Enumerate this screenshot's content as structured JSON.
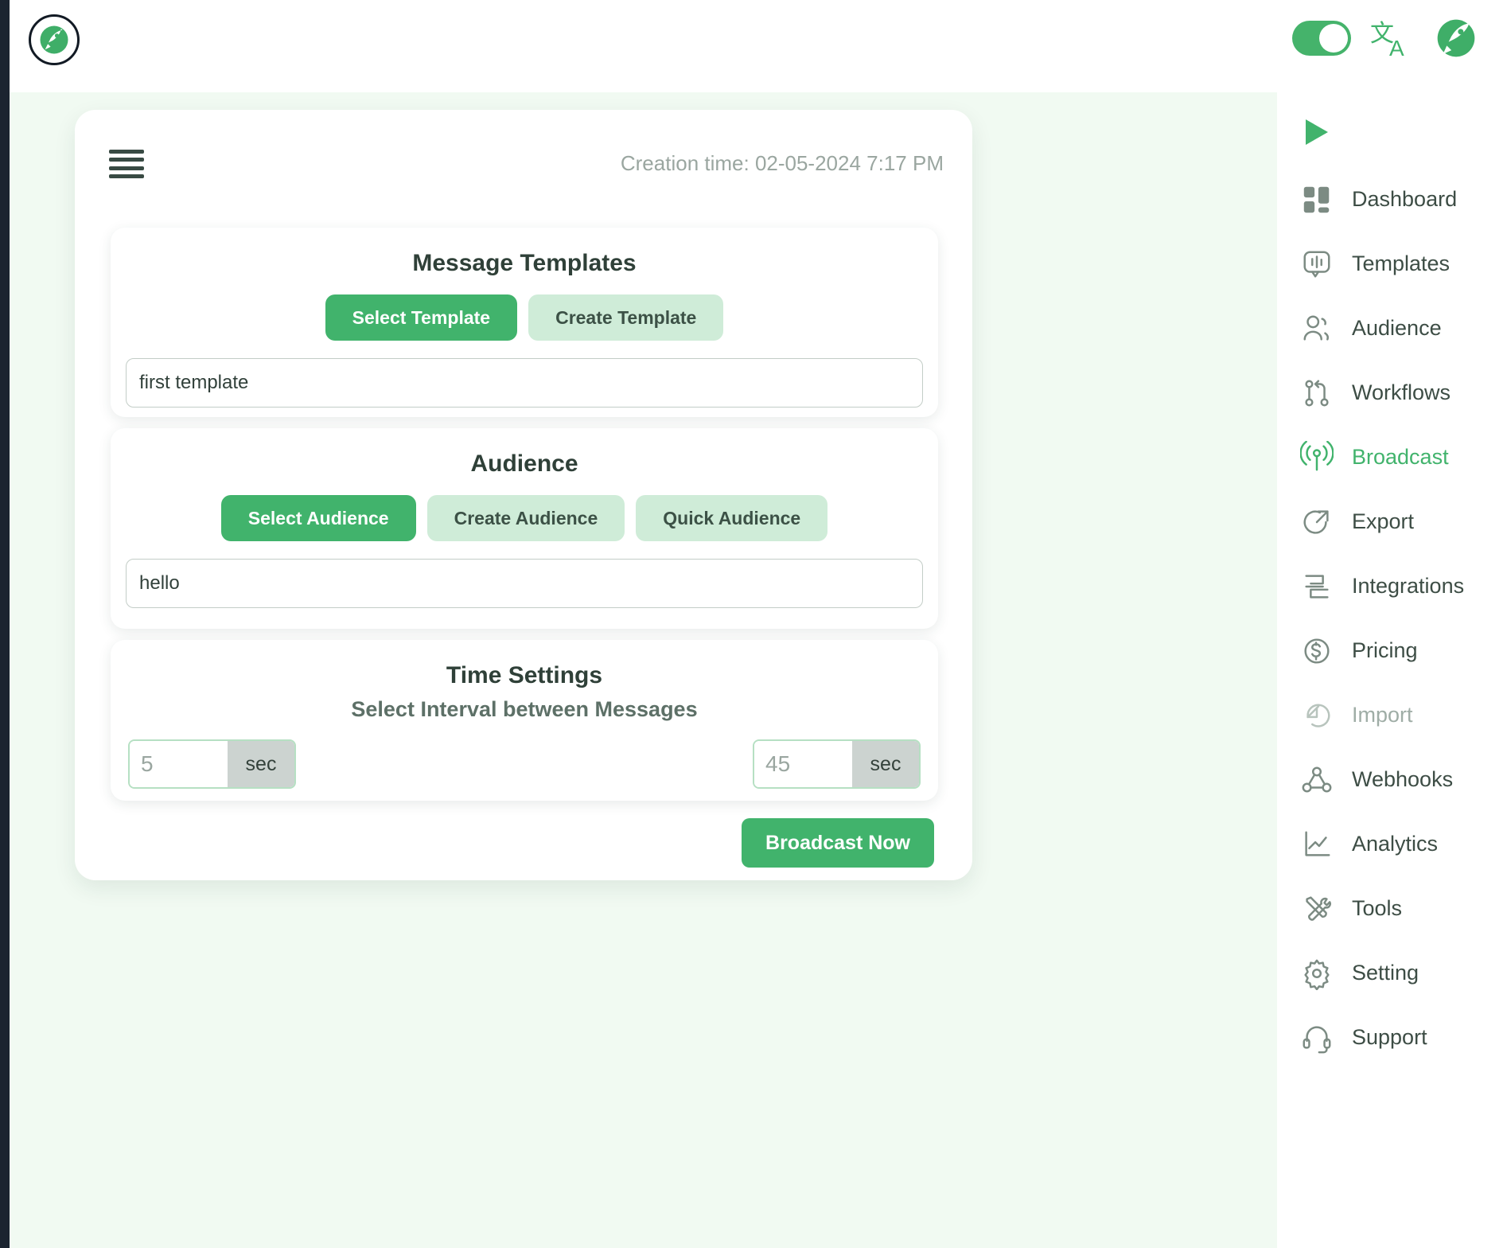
{
  "header": {
    "logo_icon": "rocket-logo-icon",
    "language_toggle_on": true,
    "translate_icon": "translate-icon",
    "rocket_icon": "rocket-icon"
  },
  "panel": {
    "menu_icon": "hamburger-menu-icon",
    "creation_time": "Creation time: 02-05-2024 7:17 PM"
  },
  "templates": {
    "title": "Message Templates",
    "select_button": "Select Template",
    "create_button": "Create Template",
    "input_value": "first template",
    "input_placeholder": "first template"
  },
  "audience": {
    "title": "Audience",
    "select_button": "Select Audience",
    "create_button": "Create Audience",
    "quick_button": "Quick Audience",
    "input_value": "hello",
    "input_placeholder": "hello"
  },
  "time_settings": {
    "title": "Time Settings",
    "subtitle": "Select Interval between Messages",
    "min_value": "5",
    "min_unit": "sec",
    "max_value": "45",
    "max_unit": "sec"
  },
  "actions": {
    "broadcast": "Broadcast Now"
  },
  "sidebar": {
    "play_icon": "play-icon",
    "items": [
      {
        "label": "Dashboard",
        "icon": "dashboard-icon",
        "state": "normal"
      },
      {
        "label": "Templates",
        "icon": "templates-icon",
        "state": "normal"
      },
      {
        "label": "Audience",
        "icon": "audience-icon",
        "state": "normal"
      },
      {
        "label": "Workflows",
        "icon": "workflows-icon",
        "state": "normal"
      },
      {
        "label": "Broadcast",
        "icon": "broadcast-icon",
        "state": "active"
      },
      {
        "label": "Export",
        "icon": "export-icon",
        "state": "normal"
      },
      {
        "label": "Integrations",
        "icon": "integrations-icon",
        "state": "normal"
      },
      {
        "label": "Pricing",
        "icon": "pricing-icon",
        "state": "normal"
      },
      {
        "label": "Import",
        "icon": "import-icon",
        "state": "dim"
      },
      {
        "label": "Webhooks",
        "icon": "webhooks-icon",
        "state": "normal"
      },
      {
        "label": "Analytics",
        "icon": "analytics-icon",
        "state": "normal"
      },
      {
        "label": "Tools",
        "icon": "tools-icon",
        "state": "normal"
      },
      {
        "label": "Setting",
        "icon": "setting-icon",
        "state": "normal"
      },
      {
        "label": "Support",
        "icon": "support-icon",
        "state": "normal"
      }
    ]
  },
  "colors": {
    "accent_green": "#41b36c",
    "soft_green": "#cfecd8",
    "page_bg": "#f1faf2",
    "rail_dark": "#1b2430",
    "muted_text": "#9aa6a0"
  }
}
